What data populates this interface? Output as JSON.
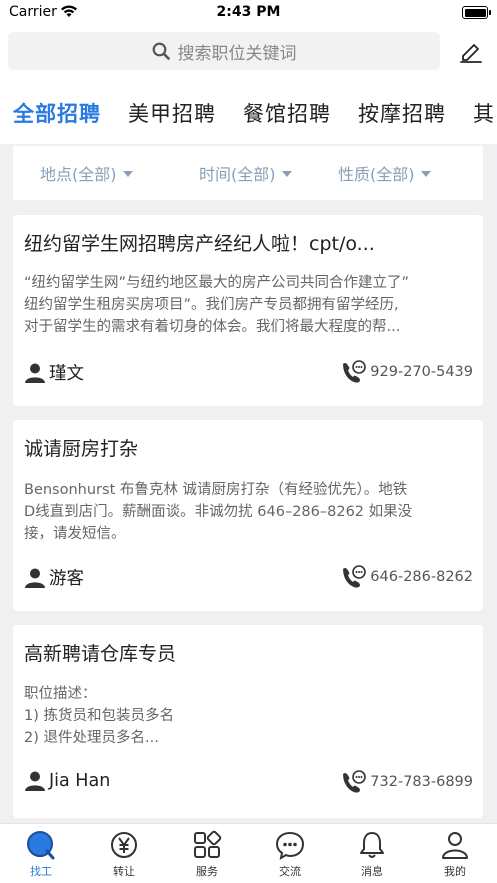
{
  "status_bar": {
    "carrier": "Carrier",
    "time": "2:43 PM"
  },
  "search": {
    "placeholder": "搜索职位关键词",
    "search_icon": "search-icon",
    "edit_icon": "edit-icon"
  },
  "category_tabs": [
    {
      "label": "全部招聘",
      "active": true
    },
    {
      "label": "美甲招聘",
      "active": false
    },
    {
      "label": "餐馆招聘",
      "active": false
    },
    {
      "label": "按摩招聘",
      "active": false
    },
    {
      "label": "其",
      "active": false
    }
  ],
  "filters": [
    {
      "label": "地点(全部)"
    },
    {
      "label": "时间(全部)"
    },
    {
      "label": "性质(全部)"
    }
  ],
  "listings": [
    {
      "title": "纽约留学生网招聘房产经纪人啦！cpt/o...",
      "desc_lines": [
        "“纽约留学生网”与纽约地区最大的房产公司共同合作建立了”",
        "纽约留学生租房买房项目”。我们房产专员都拥有留学经历,",
        "对于留学生的需求有着切身的体会。我们将最大程度的帮..."
      ],
      "user": "瑾文",
      "phone": "929-270-5439"
    },
    {
      "title": "诚请厨房打杂",
      "desc_lines": [
        "Bensonhurst 布鲁克林 诚请厨房打杂（有经验优先）。地铁",
        "D线直到店门。薪酬面谈。非诚勿扰 646–286–8262 如果没",
        "接，请发短信。"
      ],
      "user": "游客",
      "phone": "646-286-8262"
    },
    {
      "title": "高新聘请仓库专员",
      "desc_lines": [
        "职位描述：",
        "1) 拣货员和包装员多名",
        "2) 退件处理员多名..."
      ],
      "user": "Jia Han",
      "phone": "732-783-6899"
    }
  ],
  "bottom_tabs": [
    {
      "label": "找工",
      "icon": "search-tab-icon",
      "active": true
    },
    {
      "label": "转让",
      "icon": "yen-icon",
      "active": false
    },
    {
      "label": "服务",
      "icon": "grid-icon",
      "active": false
    },
    {
      "label": "交流",
      "icon": "chat-icon",
      "active": false
    },
    {
      "label": "消息",
      "icon": "bell-icon",
      "active": false
    },
    {
      "label": "我的",
      "icon": "profile-icon",
      "active": false
    }
  ],
  "colors": {
    "accent": "#2a7ae2",
    "filter_text": "#8a9fb5",
    "background": "#f0f0f2"
  }
}
